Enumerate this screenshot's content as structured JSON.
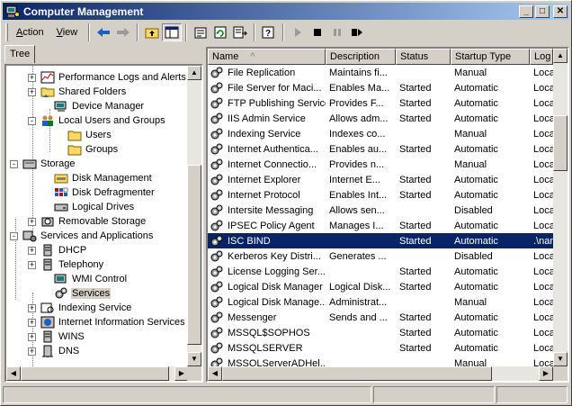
{
  "window": {
    "title": "Computer Management"
  },
  "menu": {
    "action": {
      "ul": "A",
      "rest": "ction"
    },
    "view": {
      "ul": "V",
      "rest": "iew"
    }
  },
  "tree": {
    "tab_label": "Tree",
    "nodes": [
      {
        "label": "Performance Logs and Alerts",
        "icon": "performance-icon",
        "expander": "+"
      },
      {
        "label": "Shared Folders",
        "icon": "shared-folder-icon",
        "expander": "+"
      },
      {
        "label": "Device Manager",
        "icon": "device-manager-icon",
        "expander": ""
      },
      {
        "label": "Local Users and Groups",
        "icon": "users-groups-icon",
        "expander": "-"
      },
      {
        "label": "Users",
        "icon": "folder-icon",
        "expander": ""
      },
      {
        "label": "Groups",
        "icon": "folder-icon",
        "expander": ""
      },
      {
        "label": "Storage",
        "icon": "storage-icon",
        "expander": "-"
      },
      {
        "label": "Disk Management",
        "icon": "disk-management-icon",
        "expander": ""
      },
      {
        "label": "Disk Defragmenter",
        "icon": "defragmenter-icon",
        "expander": ""
      },
      {
        "label": "Logical Drives",
        "icon": "logical-drives-icon",
        "expander": ""
      },
      {
        "label": "Removable Storage",
        "icon": "removable-storage-icon",
        "expander": "+"
      },
      {
        "label": "Services and Applications",
        "icon": "services-apps-icon",
        "expander": "-"
      },
      {
        "label": "DHCP",
        "icon": "server-icon",
        "expander": "+"
      },
      {
        "label": "Telephony",
        "icon": "server-icon",
        "expander": "+"
      },
      {
        "label": "WMI Control",
        "icon": "wmi-icon",
        "expander": ""
      },
      {
        "label": "Services",
        "icon": "gear-icon",
        "expander": ""
      },
      {
        "label": "Indexing Service",
        "icon": "indexing-icon",
        "expander": "+"
      },
      {
        "label": "Internet Information Services",
        "icon": "iis-icon",
        "expander": "+"
      },
      {
        "label": "WINS",
        "icon": "server-icon",
        "expander": "+"
      },
      {
        "label": "DNS",
        "icon": "dns-icon",
        "expander": "+"
      }
    ]
  },
  "services": {
    "columns": [
      "Name",
      "Description",
      "Status",
      "Startup Type",
      "Log O"
    ],
    "sort_indicator": "^",
    "rows": [
      [
        "File Replication",
        "Maintains fi...",
        "",
        "Manual",
        "Loca"
      ],
      [
        "File Server for Maci...",
        "Enables Ma...",
        "Started",
        "Automatic",
        "Loca"
      ],
      [
        "FTP Publishing Service",
        "Provides F...",
        "Started",
        "Automatic",
        "Loca"
      ],
      [
        "IIS Admin Service",
        "Allows adm...",
        "Started",
        "Automatic",
        "Loca"
      ],
      [
        "Indexing Service",
        "Indexes co...",
        "",
        "Manual",
        "Loca"
      ],
      [
        "Internet Authentica...",
        "Enables au...",
        "Started",
        "Automatic",
        "Loca"
      ],
      [
        "Internet Connectio...",
        "Provides n...",
        "",
        "Manual",
        "Loca"
      ],
      [
        "Internet Explorer",
        "Internet E...",
        "Started",
        "Automatic",
        "Loca"
      ],
      [
        "Internet Protocol",
        "Enables Int...",
        "Started",
        "Automatic",
        "Loca"
      ],
      [
        "Intersite Messaging",
        "Allows sen...",
        "",
        "Disabled",
        "Loca"
      ],
      [
        "IPSEC Policy Agent",
        "Manages I...",
        "Started",
        "Automatic",
        "Loca"
      ],
      [
        "ISC BIND",
        "",
        "Started",
        "Automatic",
        ".\\nar"
      ],
      [
        "Kerberos Key Distri...",
        "Generates ...",
        "",
        "Disabled",
        "Loca"
      ],
      [
        "License Logging Ser...",
        "",
        "Started",
        "Automatic",
        "Loca"
      ],
      [
        "Logical Disk Manager",
        "Logical Disk...",
        "Started",
        "Automatic",
        "Loca"
      ],
      [
        "Logical Disk Manage...",
        "Administrat...",
        "",
        "Manual",
        "Loca"
      ],
      [
        "Messenger",
        "Sends and ...",
        "Started",
        "Automatic",
        "Loca"
      ],
      [
        "MSSQL$SOPHOS",
        "",
        "Started",
        "Automatic",
        "Loca"
      ],
      [
        "MSSQLSERVER",
        "",
        "Started",
        "Automatic",
        "Loca"
      ],
      [
        "MSSQLServerADHel...",
        "",
        "",
        "Manual",
        "Loca"
      ]
    ],
    "selected_row": "ISC BIND"
  },
  "colors": {
    "titlebar_start": "#0a246a",
    "titlebar_end": "#a6caf0",
    "selection": "#0a246a",
    "chrome": "#d4d0c8"
  }
}
